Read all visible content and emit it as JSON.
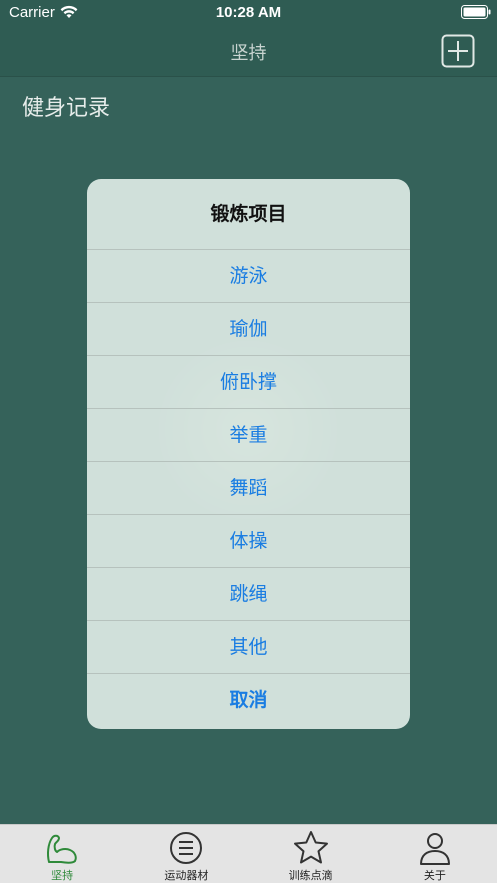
{
  "status_bar": {
    "carrier": "Carrier",
    "time": "10:28 AM"
  },
  "nav": {
    "title": "坚持",
    "add_icon": "plus-square-icon"
  },
  "page": {
    "heading": "健身记录"
  },
  "action_sheet": {
    "title": "锻炼项目",
    "options": [
      "游泳",
      "瑜伽",
      "俯卧撑",
      "举重",
      "舞蹈",
      "体操",
      "跳绳",
      "其他"
    ],
    "cancel": "取消"
  },
  "tab_bar": {
    "items": [
      {
        "label": "坚持",
        "icon": "arm-muscle-icon",
        "active": true
      },
      {
        "label": "运动器材",
        "icon": "list-circle-icon",
        "active": false
      },
      {
        "label": "训练点滴",
        "icon": "star-icon",
        "active": false
      },
      {
        "label": "关于",
        "icon": "person-icon",
        "active": false
      }
    ]
  },
  "colors": {
    "background": "#35625a",
    "accent_blue": "#1a7de2",
    "active_tab": "#2f8a3a"
  }
}
